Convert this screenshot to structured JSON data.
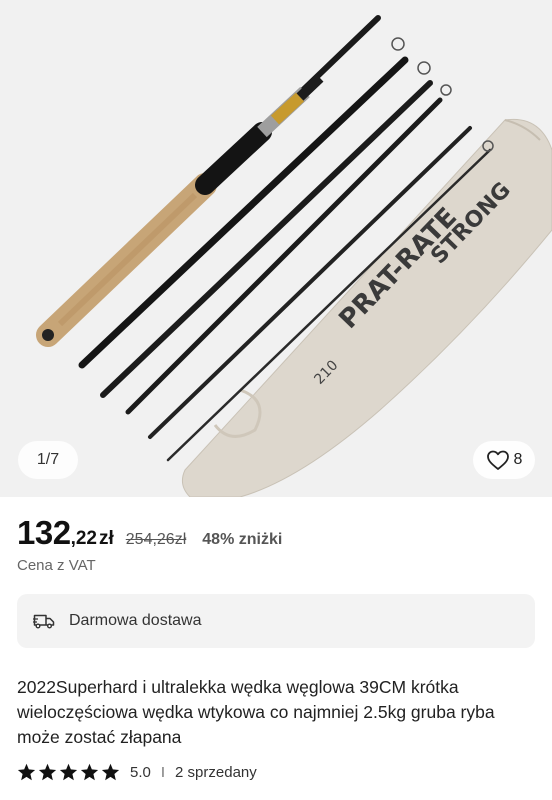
{
  "gallery": {
    "image_alt": "fishing-rod-product-photo",
    "counter": "1/7",
    "favorites_count": "8"
  },
  "price": {
    "integer": "132",
    "decimal": ",22",
    "currency": "zł",
    "old": "254,26zł",
    "discount": "48% zniżki",
    "vat_note": "Cena z VAT"
  },
  "shipping": {
    "label": "Darmowa dostawa",
    "icon": "truck-icon"
  },
  "product": {
    "title": "2022Superhard i ultralekka wędka węglowa 39CM krótka wieloczęściowa wędka wtykowa co najmniej 2.5kg gruba ryba może zostać złapana"
  },
  "rating": {
    "stars": 5,
    "score": "5.0",
    "separator": "I",
    "sold": "2 sprzedany"
  },
  "colors": {
    "background": "#ffffff",
    "gallery_bg": "#f1f1f1",
    "price": "#111111",
    "muted": "#666666",
    "chip_bg": "#f3f3f3"
  }
}
